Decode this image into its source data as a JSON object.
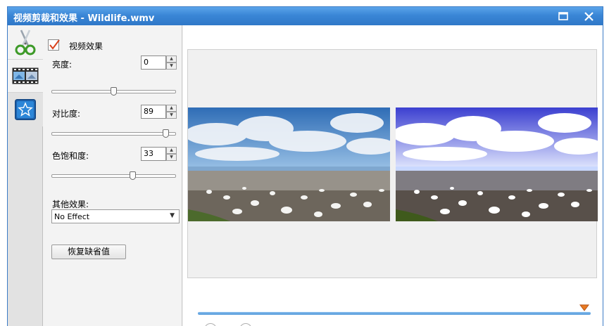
{
  "window": {
    "title": "视频剪裁和效果 - Wildlife.wmv"
  },
  "icons": {
    "maximize": "maximize-icon",
    "close": "close-icon",
    "trim": "scissors-icon",
    "film": "film-strip-icon",
    "effects": "star-icon",
    "spin_up": "arrow-up-icon",
    "spin_down": "arrow-down-icon",
    "dropdown": "chevron-down-icon",
    "marker": "position-marker-icon"
  },
  "colors": {
    "titlebar": "#3a86d6",
    "accent": "#4a93d8",
    "checkmark": "#d9421c",
    "marker": "#e87a22"
  },
  "effects_panel": {
    "enable_label": "视频效果",
    "enabled": true,
    "brightness": {
      "label": "亮度:",
      "value": "0",
      "level": 0.5
    },
    "contrast": {
      "label": "对比度:",
      "value": "89",
      "level": 0.94
    },
    "saturation": {
      "label": "色饱和度:",
      "value": "33",
      "level": 0.66
    },
    "other_label": "其他效果:",
    "other_effect": "No Effect",
    "reset_label": "恢复缺省值"
  },
  "timeline": {
    "position": 1.0
  }
}
